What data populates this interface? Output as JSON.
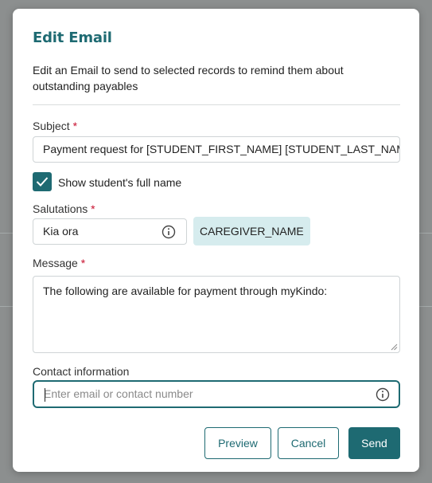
{
  "dialog": {
    "title": "Edit Email",
    "description": "Edit an Email to send to selected records to remind them about outstanding payables"
  },
  "subject": {
    "label": "Subject",
    "required_mark": "*",
    "value": "Payment request for [STUDENT_FIRST_NAME] [STUDENT_LAST_NAME]"
  },
  "show_full_name": {
    "label": "Show student's full name",
    "checked": true
  },
  "salutations": {
    "label": "Salutations",
    "required_mark": "*",
    "value": "Kia ora",
    "info_icon": "info-icon",
    "token": "CAREGIVER_NAME"
  },
  "message": {
    "label": "Message",
    "required_mark": "*",
    "value": "The following are available for payment through myKindo:"
  },
  "contact": {
    "label": "Contact information",
    "placeholder": "Enter email or contact number",
    "info_icon": "info-icon"
  },
  "actions": {
    "preview": "Preview",
    "cancel": "Cancel",
    "send": "Send"
  },
  "colors": {
    "accent": "#1e6a72",
    "required": "#c8102e",
    "chip_bg": "#d6ecee"
  }
}
